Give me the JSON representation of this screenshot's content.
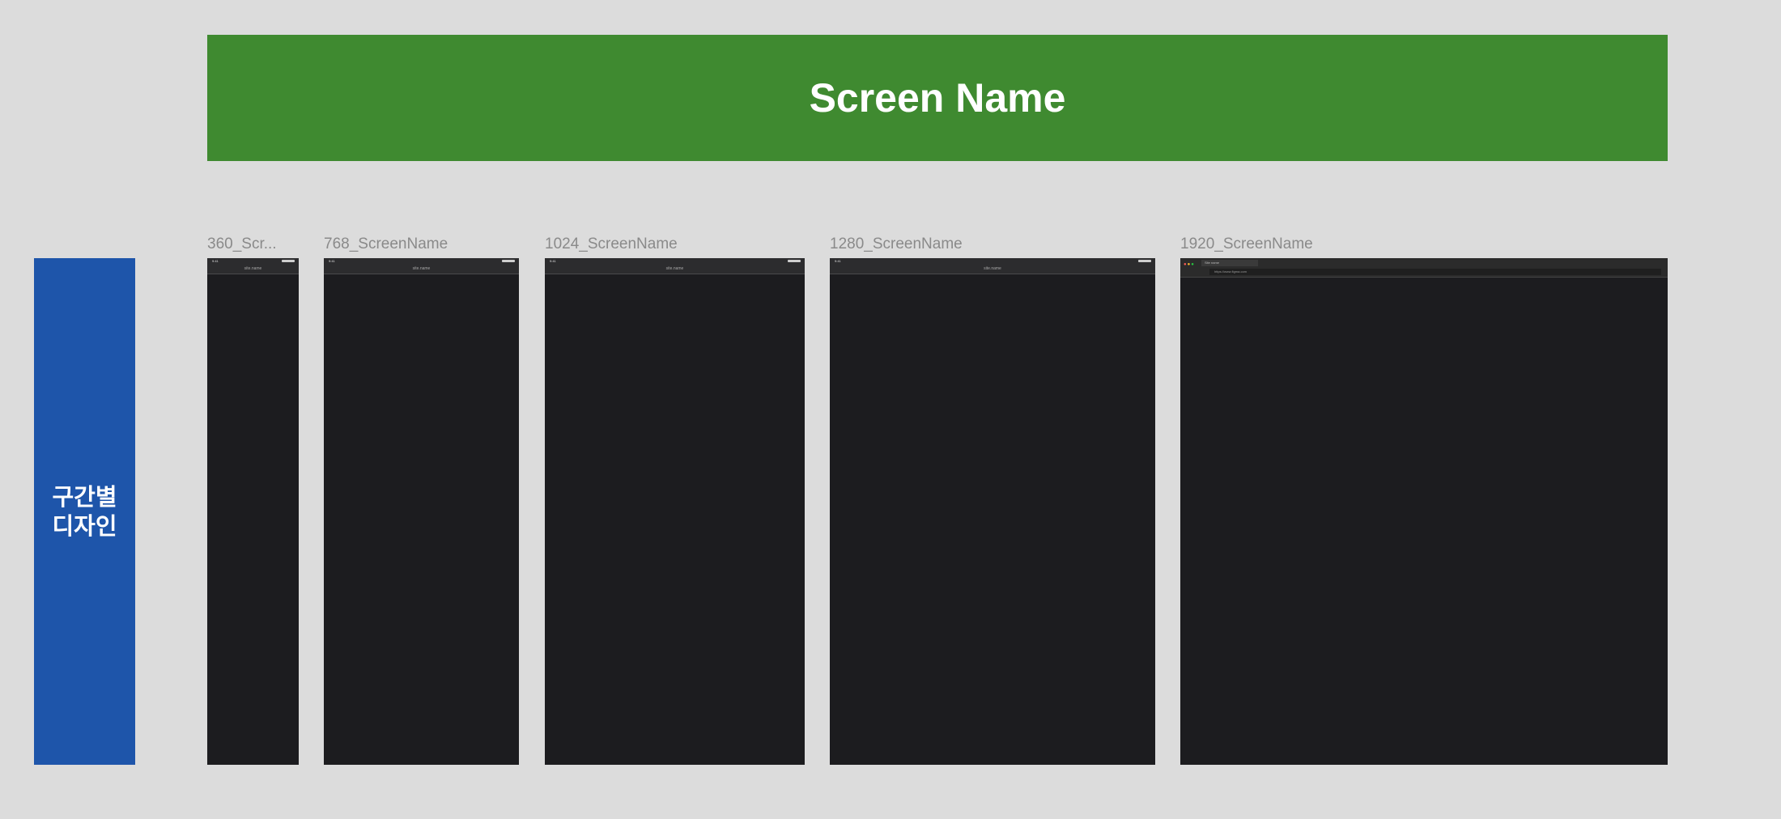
{
  "header": {
    "title": "Screen Name",
    "color": "#3f8a30"
  },
  "side_label": {
    "text": "구간별\n디자인",
    "color": "#1e55aa"
  },
  "frame_color": "#1c1c1f",
  "frames": [
    {
      "name": "360_Scr...",
      "kind": "mobile",
      "url": "site.name",
      "time": "9:41"
    },
    {
      "name": "768_ScreenName",
      "kind": "tablet",
      "url": "site.name",
      "time": "9:41"
    },
    {
      "name": "1024_ScreenName",
      "kind": "tablet",
      "url": "site.name",
      "time": "9:41"
    },
    {
      "name": "1280_ScreenName",
      "kind": "tablet",
      "url": "site.name",
      "time": "9:41"
    },
    {
      "name": "1920_ScreenName",
      "kind": "desktop",
      "url": "https://www.figma.com",
      "tab": "Site name"
    }
  ]
}
